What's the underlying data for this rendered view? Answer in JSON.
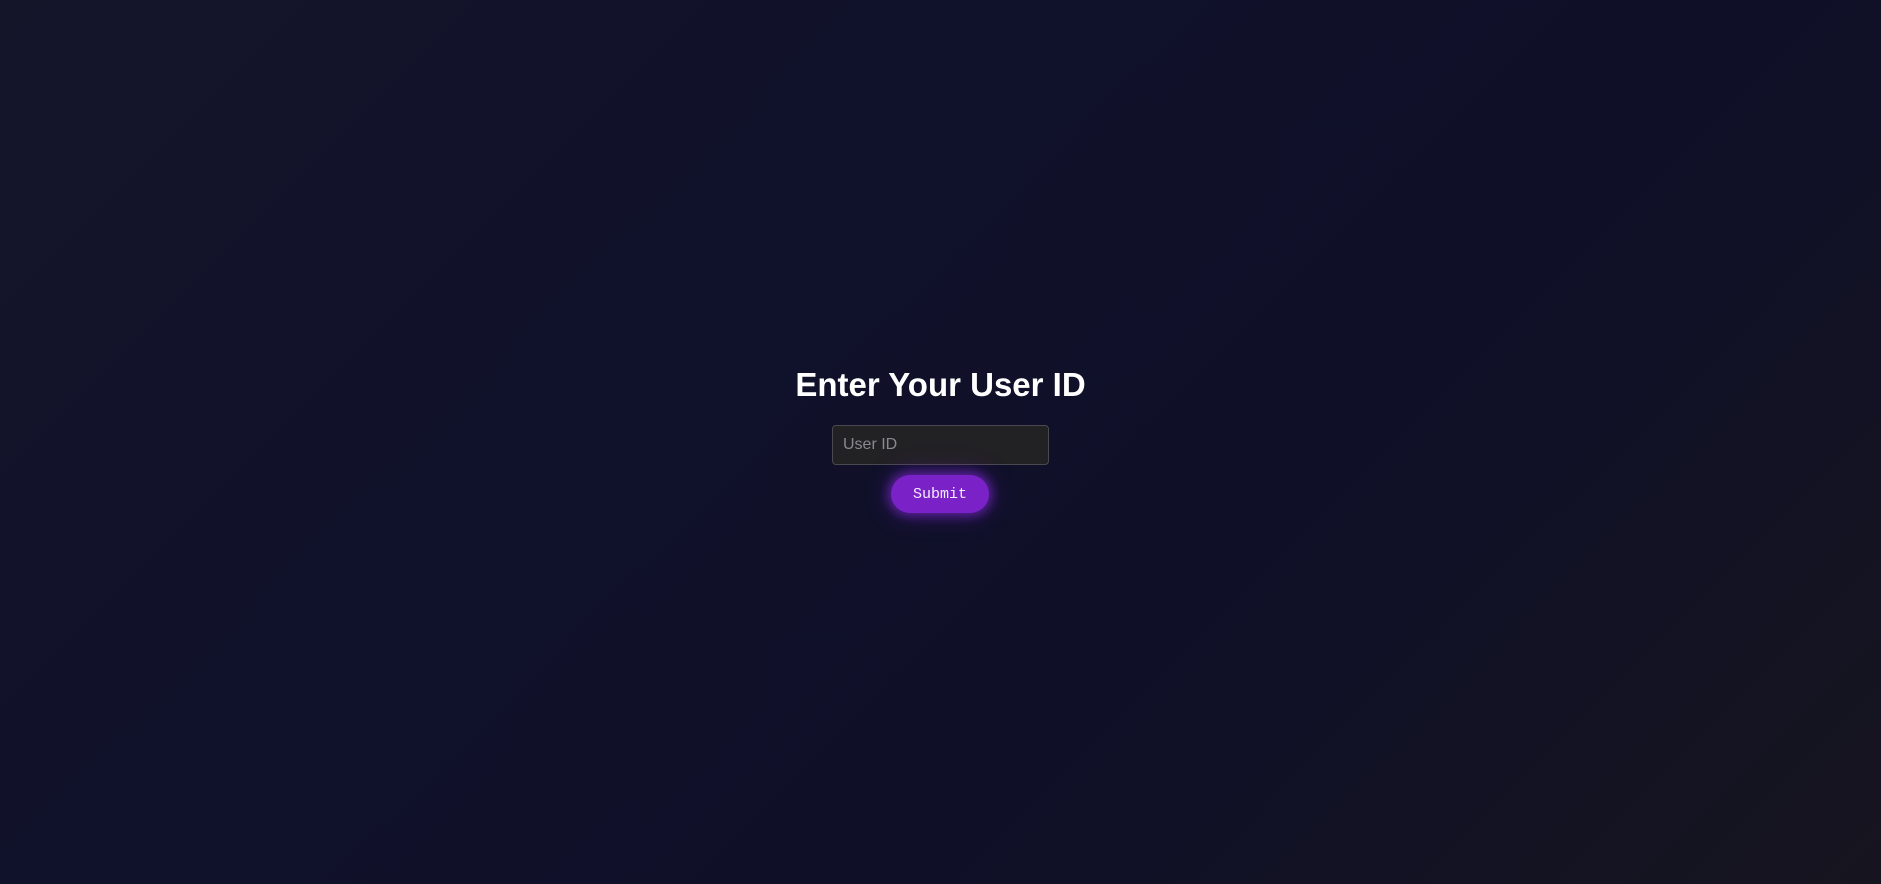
{
  "form": {
    "title": "Enter Your User ID",
    "input_placeholder": "User ID",
    "input_value": "",
    "submit_label": "Submit"
  },
  "colors": {
    "background": "#10112a",
    "accent": "#7a22c7",
    "input_background": "#222124",
    "title_text": "#ffffff"
  }
}
